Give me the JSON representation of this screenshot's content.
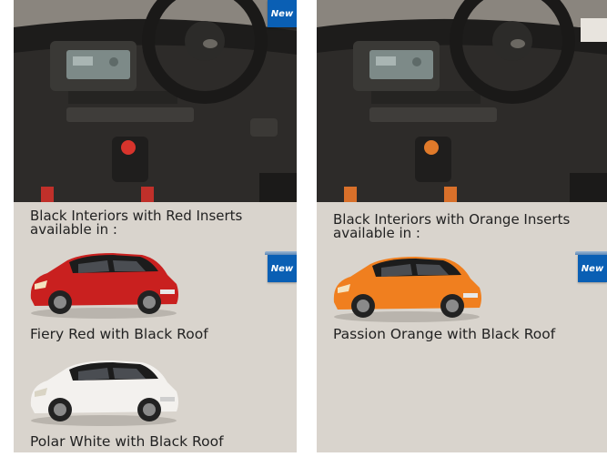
{
  "colors": {
    "panel_background": "#d9d4cd",
    "badge_blue": "#0a5fb4",
    "text": "#222222",
    "car_red": "#c9201f",
    "car_orange": "#f07f1f",
    "car_white": "#f3f1ee",
    "roof_black": "#1c1c1c"
  },
  "panels": [
    {
      "interior_badge": "New",
      "heading": "Black Interiors with Red Inserts available in :",
      "cars": [
        {
          "icon": "red-hatchback-image",
          "label": "Fiery Red with Black Roof",
          "badge": "New"
        },
        {
          "icon": "white-hatchback-image",
          "label": "Polar White with Black Roof"
        }
      ]
    },
    {
      "heading": "Black Interiors with Orange Inserts available in :",
      "cars": [
        {
          "icon": "orange-hatchback-image",
          "label": "Passion Orange with Black Roof",
          "badge": "New"
        }
      ]
    }
  ]
}
